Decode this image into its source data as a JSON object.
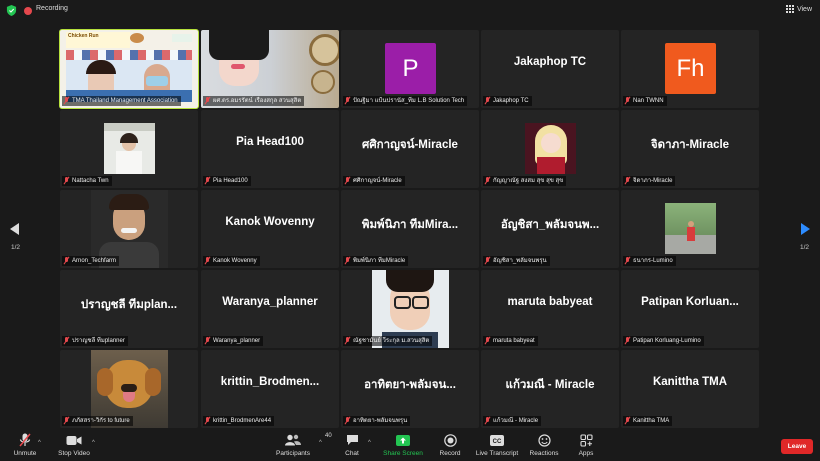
{
  "topbar": {
    "recording_label": "Recording",
    "view_label": "View"
  },
  "pagination": {
    "left": "1/2",
    "right": "1/2"
  },
  "tiles": [
    {
      "name": "TMA Thailand Management Association",
      "type": "screen",
      "active": true
    },
    {
      "name": "ผศ.ดร.อมรรัตน์ เรืองสกุล  สวนสุสิต",
      "type": "photo-woman"
    },
    {
      "name": "ปัณฐิมา แป้นปรานัส_ทีม L.B Solution Tech",
      "type": "avatar",
      "initial": "P",
      "color": "#9b1ea8"
    },
    {
      "name": "Jakaphop TC",
      "display": "Jakaphop TC",
      "type": "text"
    },
    {
      "name": "Nan TWNN",
      "type": "avatar",
      "initial": "Fh",
      "color": "#f05a1e"
    },
    {
      "name": "Nattacha Twn",
      "type": "photo-small"
    },
    {
      "name": "Pia Head100",
      "display": "Pia Head100",
      "type": "text"
    },
    {
      "name": "ศศิกาญจน์-Miracle",
      "display": "ศศิกาญจน์-Miracle",
      "type": "text"
    },
    {
      "name": "กัญญาณัฐ สงสม สุข สุข สุข",
      "type": "photo-anime"
    },
    {
      "name": "จิดาภา-Miracle",
      "display": "จิดาภา-Miracle",
      "type": "text"
    },
    {
      "name": "Arnon_Techfarm",
      "type": "photo-man"
    },
    {
      "name": "Kanok Wovenny",
      "display": "Kanok Wovenny",
      "type": "text"
    },
    {
      "name": "พิมพ์นิภา ทีมMiracle",
      "display": "พิมพ์นิภา ทีมMira...",
      "type": "text"
    },
    {
      "name": "อัญชิสา_พลัมจนพรุน",
      "display": "อัญชิสา_พลัมจนพ...",
      "type": "text"
    },
    {
      "name": "ธนากร-Lumino",
      "type": "photo-outdoor"
    },
    {
      "name": "ปราญชลี ทีมplanner",
      "display": "ปราญชลี ทีมplan...",
      "type": "text"
    },
    {
      "name": "Waranya_planner",
      "display": "Waranya_planner",
      "type": "text"
    },
    {
      "name": "ณัฐชามันย์ วีระกุล ม.สวนสุสิต",
      "type": "photo-glasses"
    },
    {
      "name": "maruta babyeat",
      "display": "maruta babyeat",
      "type": "text"
    },
    {
      "name": "Patipan Korluang-Lumino",
      "display": "Patipan  Korluan...",
      "type": "text"
    },
    {
      "name": "ภภัสสรา-วิกัร to future",
      "type": "photo-dog"
    },
    {
      "name": "krittin_BrodmenAre44",
      "display": "krittin_Brodmen...",
      "type": "text"
    },
    {
      "name": "อาทิตยา-พลัมจนพรุน",
      "display": "อาทิตยา-พลัมจน...",
      "type": "text"
    },
    {
      "name": "แก้วมณี - Miracle",
      "display": "แก้วมณี - Miracle",
      "type": "text"
    },
    {
      "name": "Kanittha TMA",
      "display": "Kanittha TMA",
      "type": "text"
    }
  ],
  "toolbar": {
    "unmute": "Unmute",
    "stop_video": "Stop Video",
    "participants": "Participants",
    "participants_count": "40",
    "chat": "Chat",
    "share_screen": "Share Screen",
    "record": "Record",
    "live_transcript": "Live Transcript",
    "reactions": "Reactions",
    "apps": "Apps",
    "leave": "Leave"
  },
  "screen_share": {
    "headline": "Chicken Run"
  },
  "colors": {
    "accent": "#2d8cff",
    "share_green": "#23c552",
    "leave_red": "#e02828",
    "active_border": "#b6e13c"
  }
}
